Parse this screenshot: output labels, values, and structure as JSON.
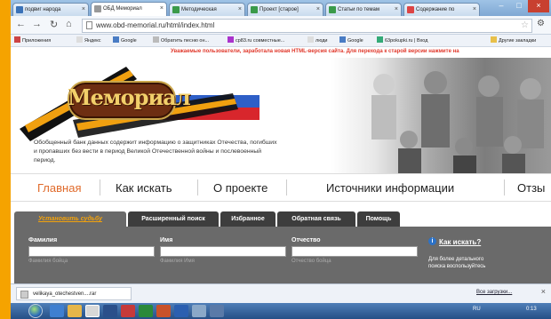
{
  "browser": {
    "tabs": [
      {
        "label": "подвиг народа"
      },
      {
        "label": "ОБД Мемориал"
      },
      {
        "label": "Методическая"
      },
      {
        "label": "Проект [старое]"
      },
      {
        "label": "Статьи по темам"
      },
      {
        "label": "Содержание по"
      }
    ],
    "url": "www.obd-memorial.ru/html/index.html",
    "bookmarks": [
      "Приложения",
      "Яндекс",
      "Google",
      "Обратить песню он...",
      "cp83.ru совместные...",
      "люди",
      "Google",
      "63pokupki.ru | Вход"
    ],
    "other_bookmarks": "Другие закладки"
  },
  "site": {
    "notice": "Уважаемые пользователи, заработала новая HTML-версия сайта. Для перехода к старой версии нажмите на",
    "logo_text": "Мемориал",
    "description": "Обобщенный банк данных содержит информацию о защитниках Отечества, погибших и пропавших без вести в период Великой Отечественной войны и послевоенный период.",
    "menu": [
      "Главная",
      "Как искать",
      "О проекте",
      "Источники информации",
      "Отзы"
    ],
    "panel_tabs": [
      "Установить судьбу",
      "Расширенный поиск",
      "Избранное",
      "Обратная связь",
      "Помощь"
    ],
    "fields": [
      {
        "label": "Фамилия",
        "hint": "Фамилия бойца"
      },
      {
        "label": "Имя",
        "hint": "Фамилия Имя"
      },
      {
        "label": "Отчество",
        "hint": "Отчество бойца"
      }
    ],
    "how_link": "Как искать?",
    "how_desc": "Для более детального поиска воспользуйтесь"
  },
  "downloads": {
    "file": "velikaya_otechestven....rar",
    "show_all": "Все загрузки..."
  },
  "taskbar": {
    "tray": "RU",
    "clock": "0:13"
  },
  "colors": {
    "accent": "#e06a2a",
    "panel_bg": "#6a6a6a",
    "notice": "#e0382b",
    "orange_tab": "#f2a20c"
  }
}
